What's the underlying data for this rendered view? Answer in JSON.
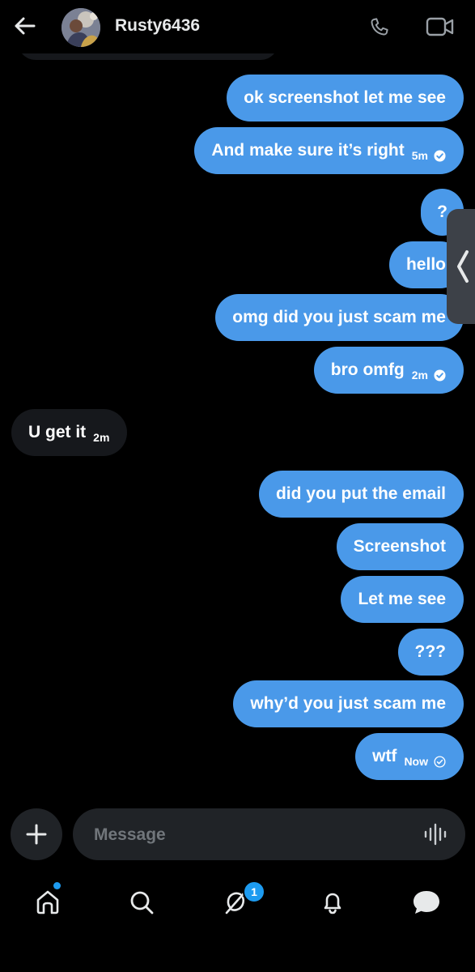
{
  "header": {
    "username": "Rusty6436"
  },
  "messages": [
    {
      "direction": "out",
      "text": "ok screenshot let me see"
    },
    {
      "direction": "out",
      "text": "And make sure it’s right",
      "time": "5m",
      "status": "read"
    },
    {
      "direction": "out",
      "text": "?"
    },
    {
      "direction": "out",
      "text": "hello"
    },
    {
      "direction": "out",
      "text": "omg did you just scam me"
    },
    {
      "direction": "out",
      "text": "bro omfg",
      "time": "2m",
      "status": "read"
    },
    {
      "direction": "in",
      "text": "U get it",
      "time": "2m"
    },
    {
      "direction": "out",
      "text": "did you put the email"
    },
    {
      "direction": "out",
      "text": "Screenshot"
    },
    {
      "direction": "out",
      "text": "Let me see"
    },
    {
      "direction": "out",
      "text": "???"
    },
    {
      "direction": "out",
      "text": "why’d you just scam me"
    },
    {
      "direction": "out",
      "text": "wtf",
      "time": "Now",
      "status": "sent"
    }
  ],
  "composer": {
    "placeholder": "Message"
  },
  "nav": {
    "items": [
      {
        "name": "home",
        "icon": "home-icon",
        "has_dot": true
      },
      {
        "name": "search",
        "icon": "search-icon"
      },
      {
        "name": "grok",
        "icon": "grok-icon",
        "badge": "1"
      },
      {
        "name": "notifications",
        "icon": "bell-icon"
      },
      {
        "name": "messages",
        "icon": "chat-bubble-icon",
        "active": true
      }
    ]
  },
  "colors": {
    "background": "#000000",
    "outgoing_bubble": "#4a99e9",
    "incoming_bubble": "#16181c",
    "accent": "#1d9bf0",
    "input_background": "#202327"
  }
}
